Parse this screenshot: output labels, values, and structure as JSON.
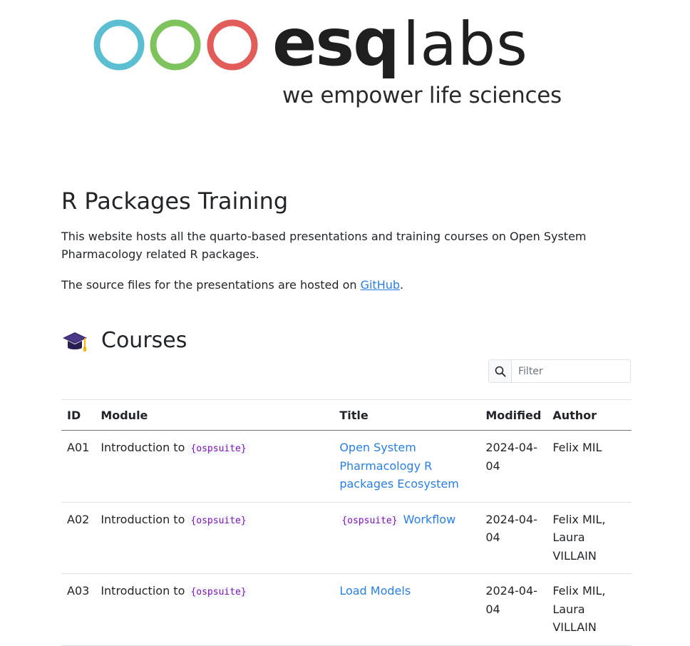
{
  "brand": {
    "name_bold": "esq",
    "name_light": "labs",
    "tagline": "we empower life sciences",
    "colors": {
      "circle1": "#5bbfd1",
      "circle2": "#7fc35d",
      "circle3": "#e25c59",
      "text": "#1f1f1f"
    }
  },
  "page": {
    "title": "R Packages Training",
    "intro": "This website hosts all the quarto-based presentations and training courses on Open System Pharmacology related R packages.",
    "source_prefix": "The source files for the presentations are hosted on ",
    "source_link": "GitHub",
    "source_suffix": "."
  },
  "courses": {
    "heading": "Courses",
    "icon": "graduation-cap-icon",
    "filter_placeholder": "Filter",
    "filter_icon": "search-icon",
    "columns": [
      "ID",
      "Module",
      "Title",
      "Modified",
      "Author"
    ],
    "rows": [
      {
        "id": "A01",
        "module_prefix": "Introduction to ",
        "module_code": "{ospsuite}",
        "title_code": "",
        "title_text": "Open System Pharmacology R packages Ecosystem",
        "modified": "2024-04-04",
        "author": "Felix MIL"
      },
      {
        "id": "A02",
        "module_prefix": "Introduction to ",
        "module_code": "{ospsuite}",
        "title_code": "{ospsuite}",
        "title_text": " Workflow",
        "modified": "2024-04-04",
        "author": "Felix MIL, Laura VILLAIN"
      },
      {
        "id": "A03",
        "module_prefix": "Introduction to ",
        "module_code": "{ospsuite}",
        "title_code": "",
        "title_text": "Load Models",
        "modified": "2024-04-04",
        "author": "Felix MIL, Laura VILLAIN"
      }
    ]
  }
}
